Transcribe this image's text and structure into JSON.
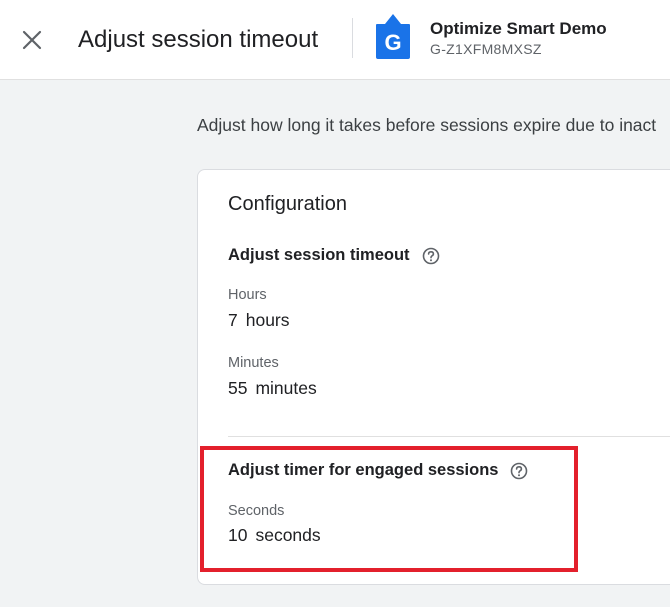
{
  "header": {
    "close_icon": "close-icon",
    "title": "Adjust session timeout",
    "property": {
      "icon": "google-analytics-property-icon",
      "icon_letter": "G",
      "name": "Optimize Smart Demo",
      "id": "G-Z1XFM8MXSZ"
    }
  },
  "main": {
    "description": "Adjust how long it takes before sessions expire due to inact",
    "card": {
      "title": "Configuration",
      "session_timeout": {
        "heading": "Adjust session timeout",
        "help_icon": "help-circle-icon",
        "hours": {
          "label": "Hours",
          "value": "7",
          "unit": "hours"
        },
        "minutes": {
          "label": "Minutes",
          "value": "55",
          "unit": "minutes"
        }
      },
      "engaged_sessions": {
        "heading": "Adjust timer for engaged sessions",
        "help_icon": "help-circle-icon",
        "seconds": {
          "label": "Seconds",
          "value": "10",
          "unit": "seconds"
        }
      }
    }
  },
  "colors": {
    "accent_blue": "#1a73e8",
    "highlight_red": "#e3202c",
    "page_background": "#f1f3f4"
  }
}
